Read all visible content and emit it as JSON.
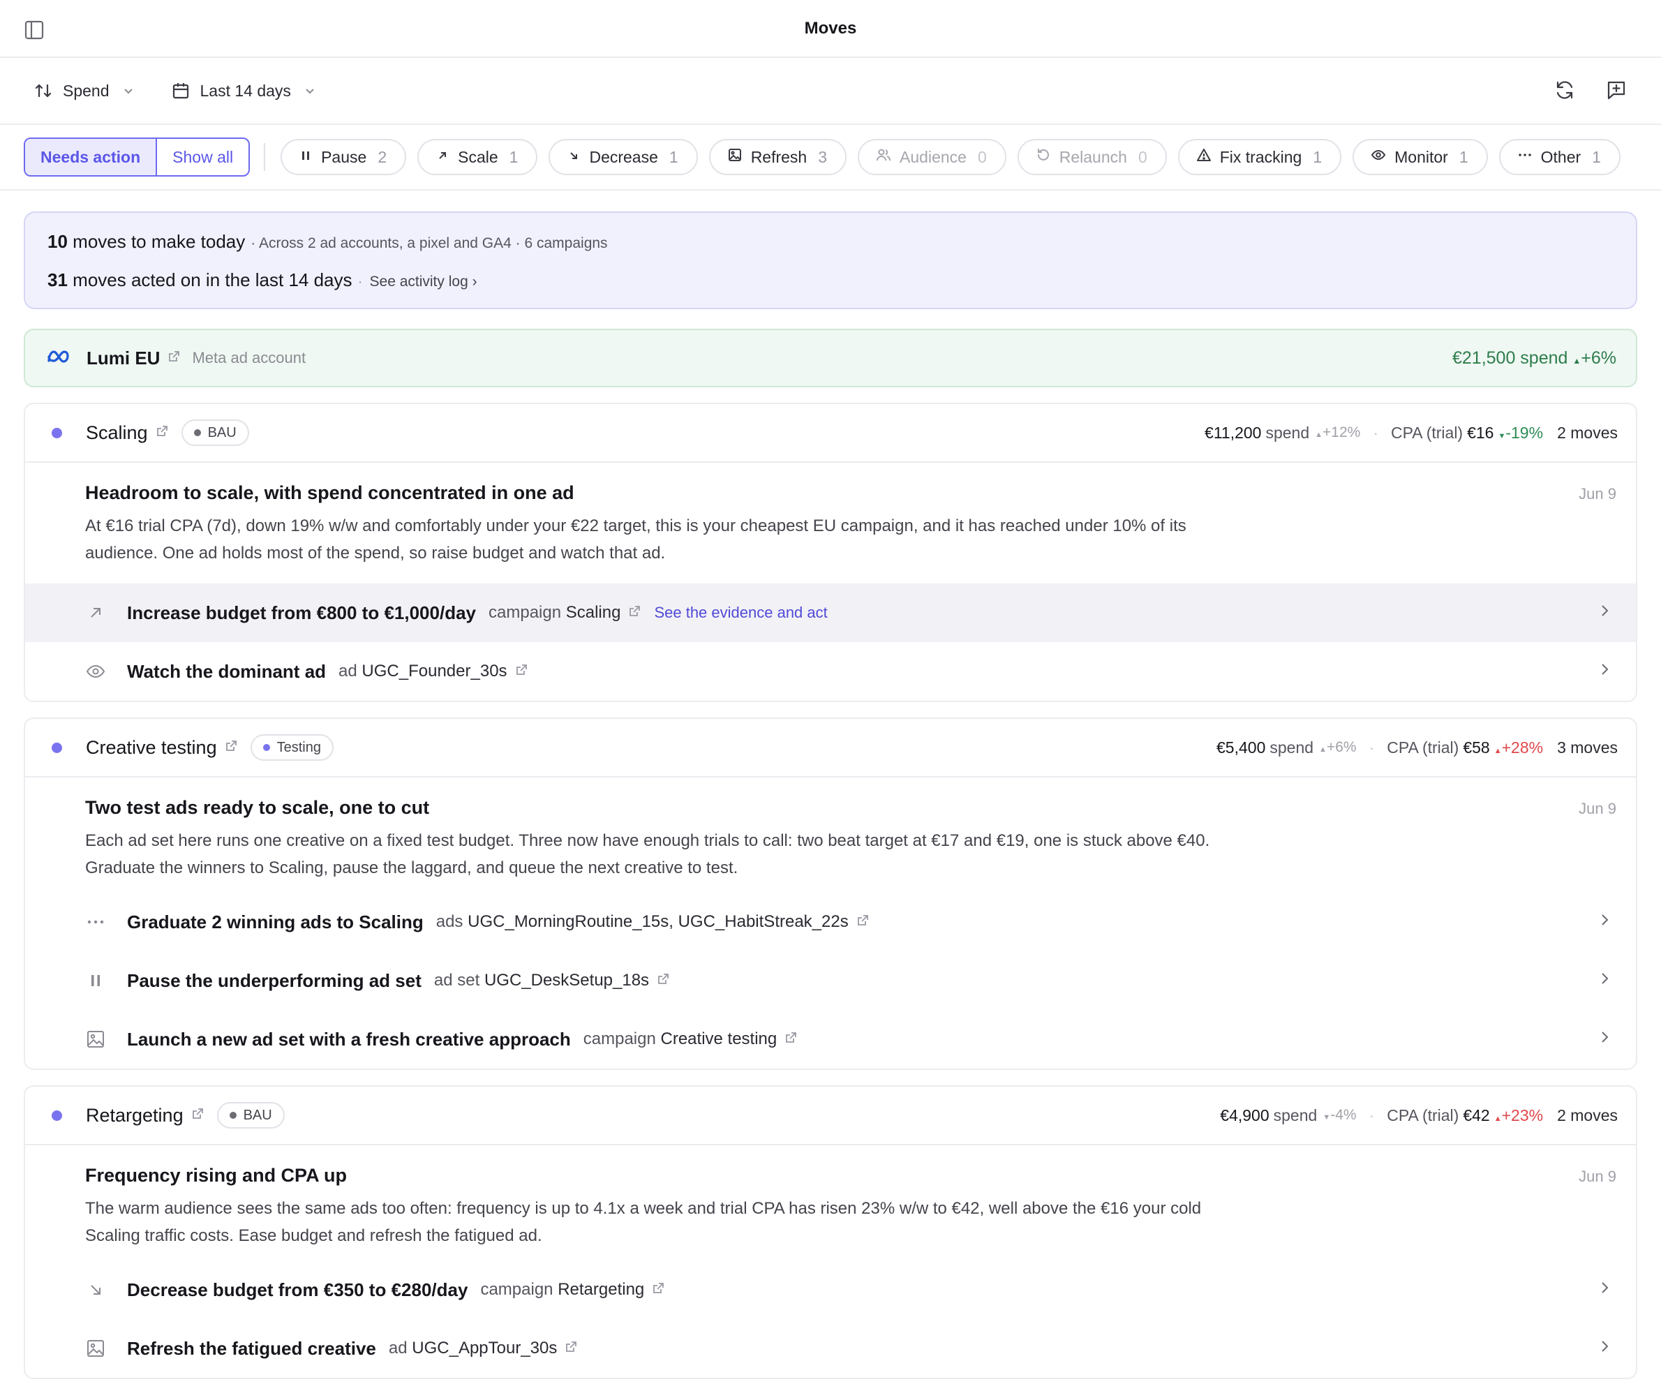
{
  "header": {
    "title": "Moves"
  },
  "toolbar": {
    "sort_label": "Spend",
    "date_label": "Last 14 days"
  },
  "filters": {
    "needs_action": "Needs action",
    "show_all": "Show all",
    "chips": [
      {
        "label": "Pause",
        "count": "2"
      },
      {
        "label": "Scale",
        "count": "1"
      },
      {
        "label": "Decrease",
        "count": "1"
      },
      {
        "label": "Refresh",
        "count": "3"
      },
      {
        "label": "Audience",
        "count": "0"
      },
      {
        "label": "Relaunch",
        "count": "0"
      },
      {
        "label": "Fix tracking",
        "count": "1"
      },
      {
        "label": "Monitor",
        "count": "1"
      },
      {
        "label": "Other",
        "count": "1"
      }
    ]
  },
  "summary": {
    "today_count": "10",
    "today_text": "moves to make today",
    "today_sub": "· Across 2 ad accounts, a pixel and GA4 · 6 campaigns",
    "past_count": "31",
    "past_text": "moves acted on in the last 14 days",
    "past_sep": "·",
    "activity_link": "See activity log ›"
  },
  "account": {
    "name": "Lumi EU",
    "kind": "Meta ad account",
    "spend": "€21,500 spend",
    "delta": "+6%"
  },
  "campaigns": [
    {
      "name": "Scaling",
      "badge": "BAU",
      "spend": "€11,200",
      "spend_label": "spend",
      "spend_delta": "+12%",
      "cpa_label": "CPA (trial)",
      "cpa": "€16",
      "cpa_delta": "-19%",
      "moves": "2 moves",
      "insight": {
        "title": "Headroom to scale, with spend concentrated in one ad",
        "date": "Jun 9",
        "body": "At €16 trial CPA (7d), down 19% w/w and comfortably under your €22 target, this is your cheapest EU campaign, and it has reached under 10% of its audience. One ad holds most of the spend, so raise budget and watch that ad."
      },
      "actions": [
        {
          "title": "Increase budget from €800 to €1,000/day",
          "type": "campaign",
          "target": "Scaling",
          "evidence": "See the evidence and act"
        },
        {
          "title": "Watch the dominant ad",
          "type": "ad",
          "target": "UGC_Founder_30s"
        }
      ]
    },
    {
      "name": "Creative testing",
      "badge": "Testing",
      "spend": "€5,400",
      "spend_label": "spend",
      "spend_delta": "+6%",
      "cpa_label": "CPA (trial)",
      "cpa": "€58",
      "cpa_delta": "+28%",
      "moves": "3 moves",
      "insight": {
        "title": "Two test ads ready to scale, one to cut",
        "date": "Jun 9",
        "body": "Each ad set here runs one creative on a fixed test budget. Three now have enough trials to call: two beat target at €17 and €19, one is stuck above €40. Graduate the winners to Scaling, pause the laggard, and queue the next creative to test."
      },
      "actions": [
        {
          "title": "Graduate 2 winning ads to Scaling",
          "type": "ads",
          "target": "UGC_MorningRoutine_15s, UGC_HabitStreak_22s"
        },
        {
          "title": "Pause the underperforming ad set",
          "type": "ad set",
          "target": "UGC_DeskSetup_18s"
        },
        {
          "title": "Launch a new ad set with a fresh creative approach",
          "type": "campaign",
          "target": "Creative testing"
        }
      ]
    },
    {
      "name": "Retargeting",
      "badge": "BAU",
      "spend": "€4,900",
      "spend_label": "spend",
      "spend_delta": "-4%",
      "cpa_label": "CPA (trial)",
      "cpa": "€42",
      "cpa_delta": "+23%",
      "moves": "2 moves",
      "insight": {
        "title": "Frequency rising and CPA up",
        "date": "Jun 9",
        "body": "The warm audience sees the same ads too often: frequency is up to 4.1x a week and trial CPA has risen 23% w/w to €42, well above the €16 your cold Scaling traffic costs. Ease budget and refresh the fatigued ad."
      },
      "actions": [
        {
          "title": "Decrease budget from €350 to €280/day",
          "type": "campaign",
          "target": "Retargeting"
        },
        {
          "title": "Refresh the fatigued creative",
          "type": "ad",
          "target": "UGC_AppTour_30s"
        }
      ]
    }
  ],
  "colors": {
    "accent": "#6f6af0",
    "positive": "#2e8b57",
    "negative": "#e0474c",
    "account_bg": "#eff8f2",
    "summary_bg": "#f1f1fd"
  }
}
